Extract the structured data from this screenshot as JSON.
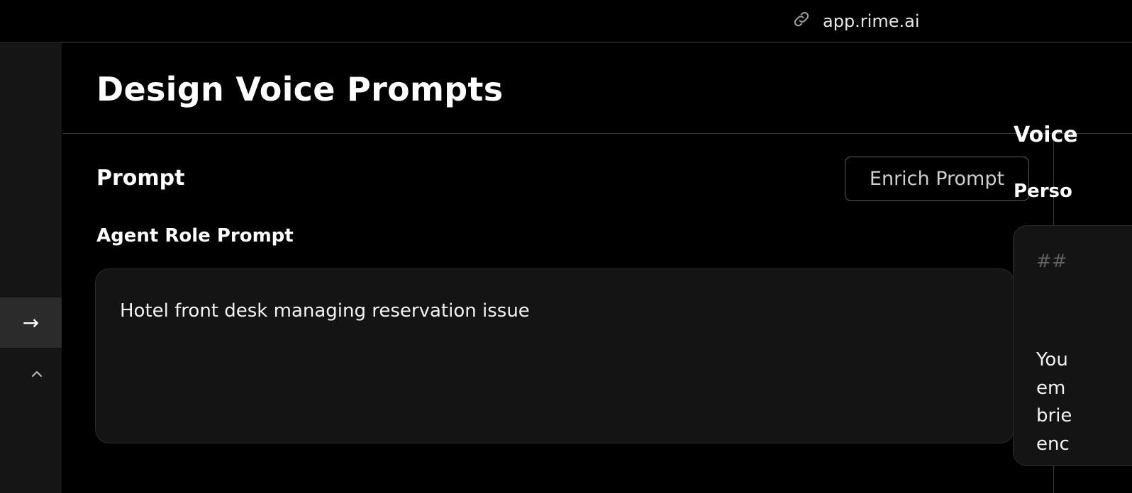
{
  "browser": {
    "url": "app.rime.ai",
    "url_icon": "link-icon"
  },
  "sidebar": {
    "expand_icon": "arrow-right-icon",
    "collapse_icon": "chevron-up-icon",
    "expand_glyph": "→"
  },
  "header": {
    "title": "Design Voice Prompts"
  },
  "prompt_panel": {
    "heading": "Prompt",
    "enrich_button": "Enrich Prompt",
    "field_label": "Agent Role Prompt",
    "field_value": "Hotel front desk managing reservation issue"
  },
  "voice_panel": {
    "heading": "Voice",
    "section_label": "Perso",
    "box_heading": "##",
    "box_lines": [
      "You",
      "em",
      "brie",
      "enc"
    ]
  }
}
